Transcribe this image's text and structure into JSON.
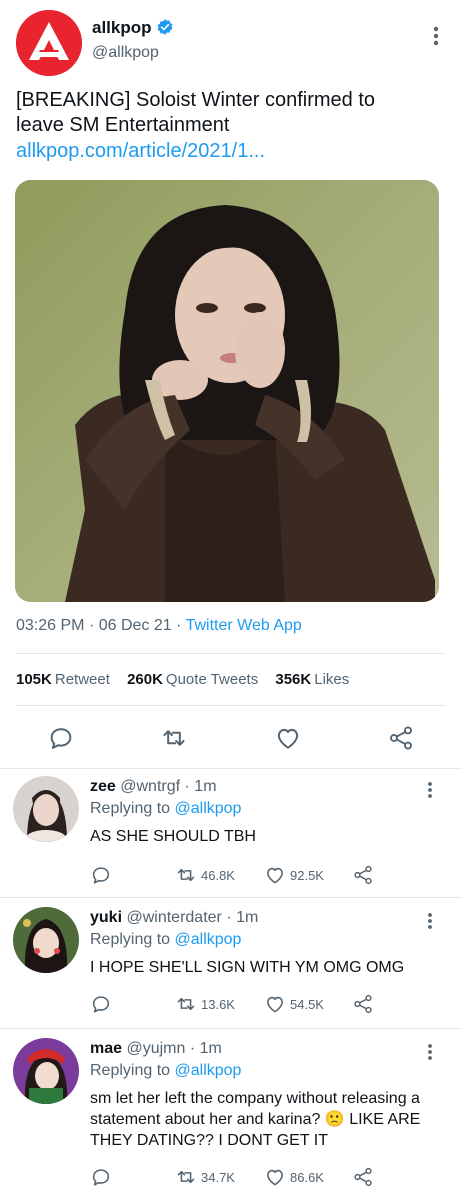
{
  "tweet": {
    "author_name": "allkpop",
    "author_handle": "@allkpop",
    "text": "[BREAKING] Soloist Winter confirmed to leave SM Entertainment",
    "link": "allkpop.com/article/2021/1...",
    "time": "03:26 PM",
    "date": "06 Dec 21",
    "separator": "·",
    "source": "Twitter Web App",
    "stats": {
      "retweets_count": "105K",
      "retweets_label": "Retweet",
      "quotes_count": "260K",
      "quotes_label": "Quote Tweets",
      "likes_count": "356K",
      "likes_label": "Likes"
    }
  },
  "replies": [
    {
      "name": "zee",
      "handle": "@wntrgf",
      "age": "· 1m",
      "replying_label": "Replying to",
      "replying_to": "@allkpop",
      "text": "AS SHE SHOULD TBH",
      "retweets": "46.8K",
      "likes": "92.5K"
    },
    {
      "name": "yuki",
      "handle": "@winterdater",
      "age": "· 1m",
      "replying_label": "Replying to",
      "replying_to": "@allkpop",
      "text": "I HOPE SHE'LL SIGN WITH YM OMG OMG",
      "retweets": "13.6K",
      "likes": "54.5K"
    },
    {
      "name": "mae",
      "handle": "@yujmn",
      "age": "· 1m",
      "replying_label": "Replying to",
      "replying_to": "@allkpop",
      "text": "sm let her left the company without releasing a statement about her and karina? 🙁 LIKE ARE THEY DATING?? I DONT GET IT",
      "retweets": "34.7K",
      "likes": "86.6K"
    }
  ],
  "colors": {
    "accent": "#1d9bf0",
    "secondary_text": "#536471",
    "logo_red": "#e8242e"
  },
  "icons": [
    "verified-badge-icon",
    "more-vertical-icon",
    "reply-icon",
    "retweet-icon",
    "like-icon",
    "share-icon"
  ]
}
